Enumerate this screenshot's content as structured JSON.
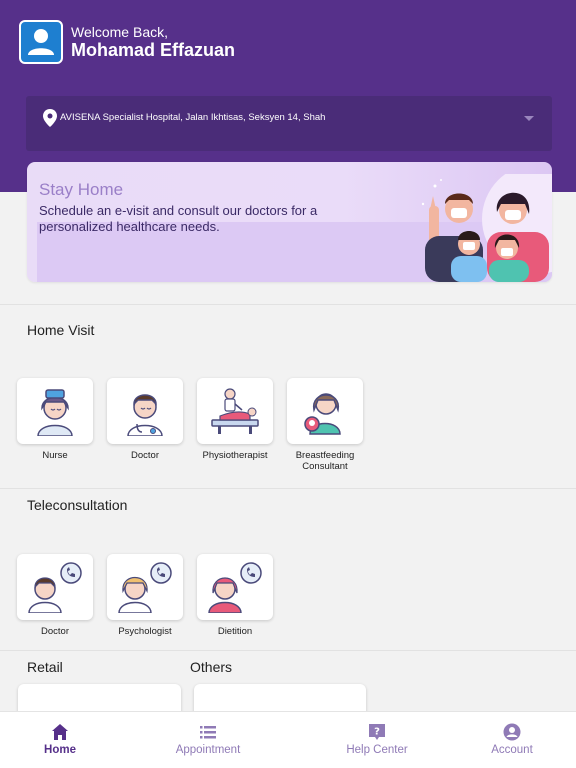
{
  "header": {
    "welcome": "Welcome Back,",
    "username": "Mohamad Effazuan",
    "avatar_icon": "user-icon"
  },
  "location": {
    "text": "AVISENA Specialist Hospital, Jalan Ikhtisas, Seksyen 14, Shah",
    "pin_icon": "location-pin-icon",
    "dropdown_icon": "chevron-down-icon"
  },
  "banner": {
    "title": "Stay Home",
    "subtitle": "Schedule an e-visit and consult our doctors for a personalized healthcare needs."
  },
  "home_visit": {
    "title": "Home Visit",
    "items": [
      {
        "label": "Nurse",
        "icon": "nurse-icon"
      },
      {
        "label": "Doctor",
        "icon": "doctor-icon"
      },
      {
        "label": "Physiotherapist",
        "icon": "physiotherapist-icon"
      },
      {
        "label": "Breastfeeding Consultant",
        "icon": "breastfeeding-consultant-icon"
      }
    ]
  },
  "teleconsultation": {
    "title": "Teleconsultation",
    "items": [
      {
        "label": "Doctor",
        "icon": "doctor-call-icon"
      },
      {
        "label": "Psychologist",
        "icon": "psychologist-call-icon"
      },
      {
        "label": "Dietition",
        "icon": "dietitian-call-icon"
      }
    ]
  },
  "retail": {
    "title": "Retail"
  },
  "others": {
    "title": "Others"
  },
  "bottom_nav": {
    "items": [
      {
        "label": "Home",
        "icon": "home-icon",
        "active": true
      },
      {
        "label": "Appointment",
        "icon": "list-icon",
        "active": false
      },
      {
        "label": "Help Center",
        "icon": "question-icon",
        "active": false
      },
      {
        "label": "Account",
        "icon": "account-icon",
        "active": false
      }
    ]
  },
  "colors": {
    "primary": "#56308a",
    "location_bg": "#4a2c78",
    "banner_bg": "#e9dcf7",
    "nav_inactive": "#8f7ab6"
  }
}
